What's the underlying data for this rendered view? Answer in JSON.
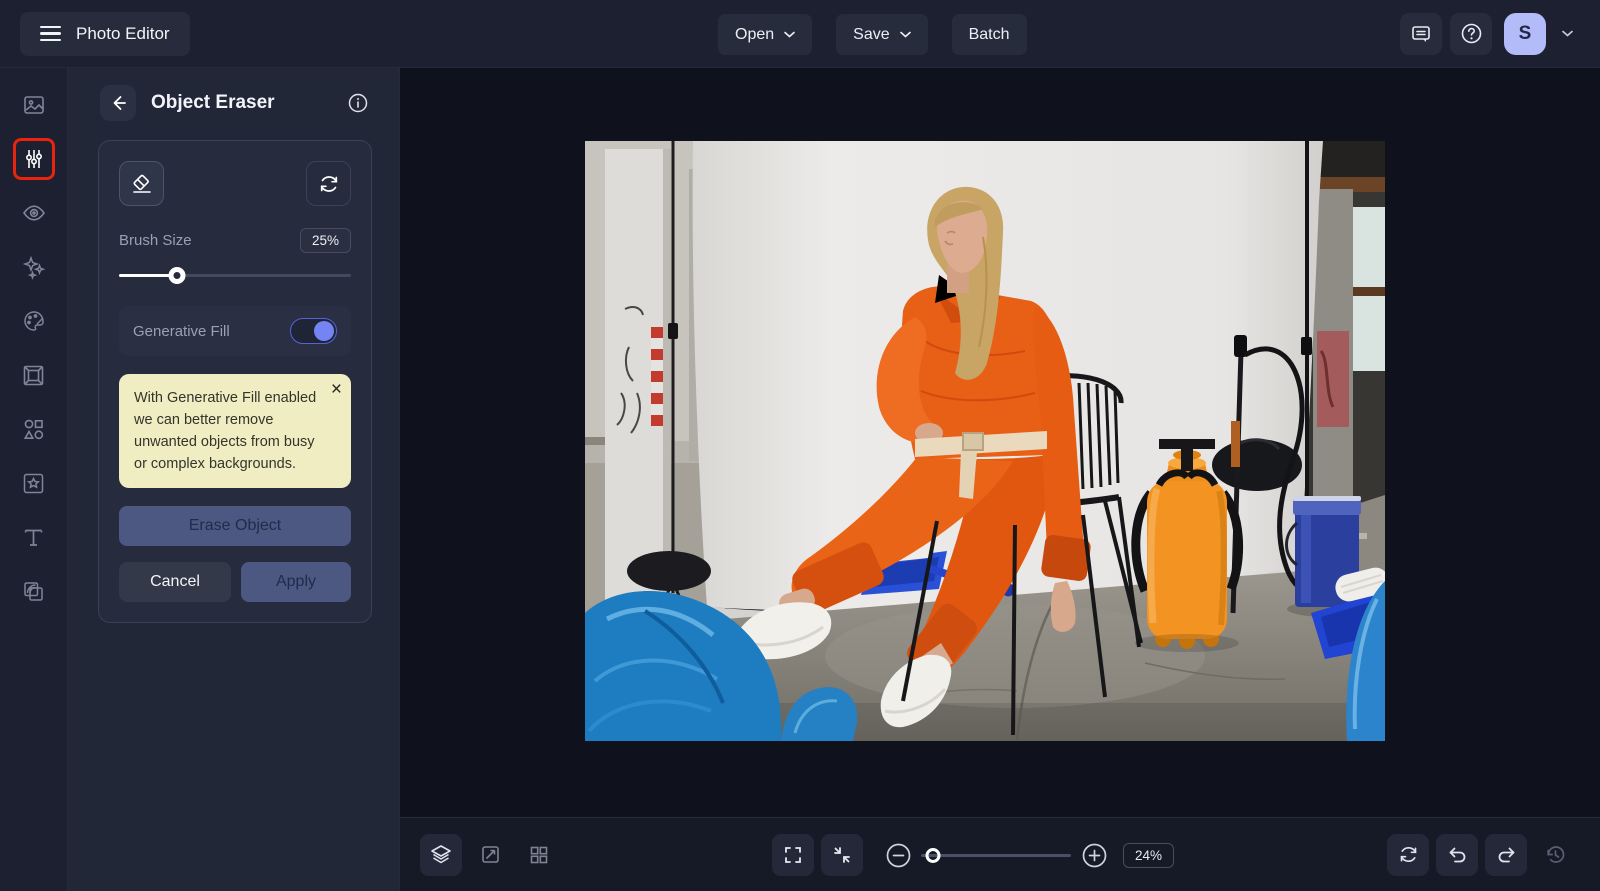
{
  "topbar": {
    "app_title": "Photo Editor",
    "open_label": "Open",
    "save_label": "Save",
    "batch_label": "Batch",
    "avatar_initial": "S",
    "icons": [
      "menu-icon",
      "chevron-down-icon",
      "feedback-icon",
      "help-icon"
    ]
  },
  "tool_rail": {
    "selected_tool": "adjustments",
    "items": [
      {
        "icon": "image-icon"
      },
      {
        "icon": "adjustments-icon",
        "selected": true
      },
      {
        "icon": "eye-icon"
      },
      {
        "icon": "sparkles-icon"
      },
      {
        "icon": "palette-icon"
      },
      {
        "icon": "frame-icon"
      },
      {
        "icon": "shapes-icon"
      },
      {
        "icon": "texture-icon"
      },
      {
        "icon": "text-icon"
      },
      {
        "icon": "overlap-icon"
      }
    ]
  },
  "panel": {
    "title": "Object Eraser",
    "tool_icons": [
      "eraser-icon",
      "reset-icon"
    ],
    "brush": {
      "label": "Brush Size",
      "value": "25%",
      "percent": 25
    },
    "generative_fill": {
      "label": "Generative Fill",
      "enabled": true
    },
    "tooltip": {
      "text": "With Generative Fill enabled we can better remove unwanted objects from busy or complex backgrounds.",
      "close": "×"
    },
    "erase_button": "Erase Object",
    "cancel_button": "Cancel",
    "apply_button": "Apply"
  },
  "canvas": {
    "description": "Model in an orange jumpsuit seated on a black wire chair in front of a white paper backdrop in an industrial hall, with blue plastic bags, paint roller trays, an orange pressure sprayer and a blue paint bucket on the concrete floor."
  },
  "bottombar": {
    "zoom": {
      "value": "24%",
      "percent": 24
    },
    "icons_left": [
      "layers-icon",
      "resize-icon",
      "grid-icon"
    ],
    "icons_center": [
      "fullscreen-icon",
      "fit-screen-icon",
      "zoom-out-icon",
      "zoom-in-icon"
    ],
    "icons_right": [
      "reset-icon",
      "undo-icon",
      "redo-icon",
      "history-icon"
    ]
  },
  "colors": {
    "accent_toggle": "#7484f3",
    "selected_tool_outline": "#e8230e",
    "tooltip_bg": "#f1edc2",
    "avatar_bg": "#b3bcf8",
    "disabled_button_bg": "#4c5882",
    "topbar_bg": "#1c2030",
    "canvas_bg": "#0f111c"
  }
}
